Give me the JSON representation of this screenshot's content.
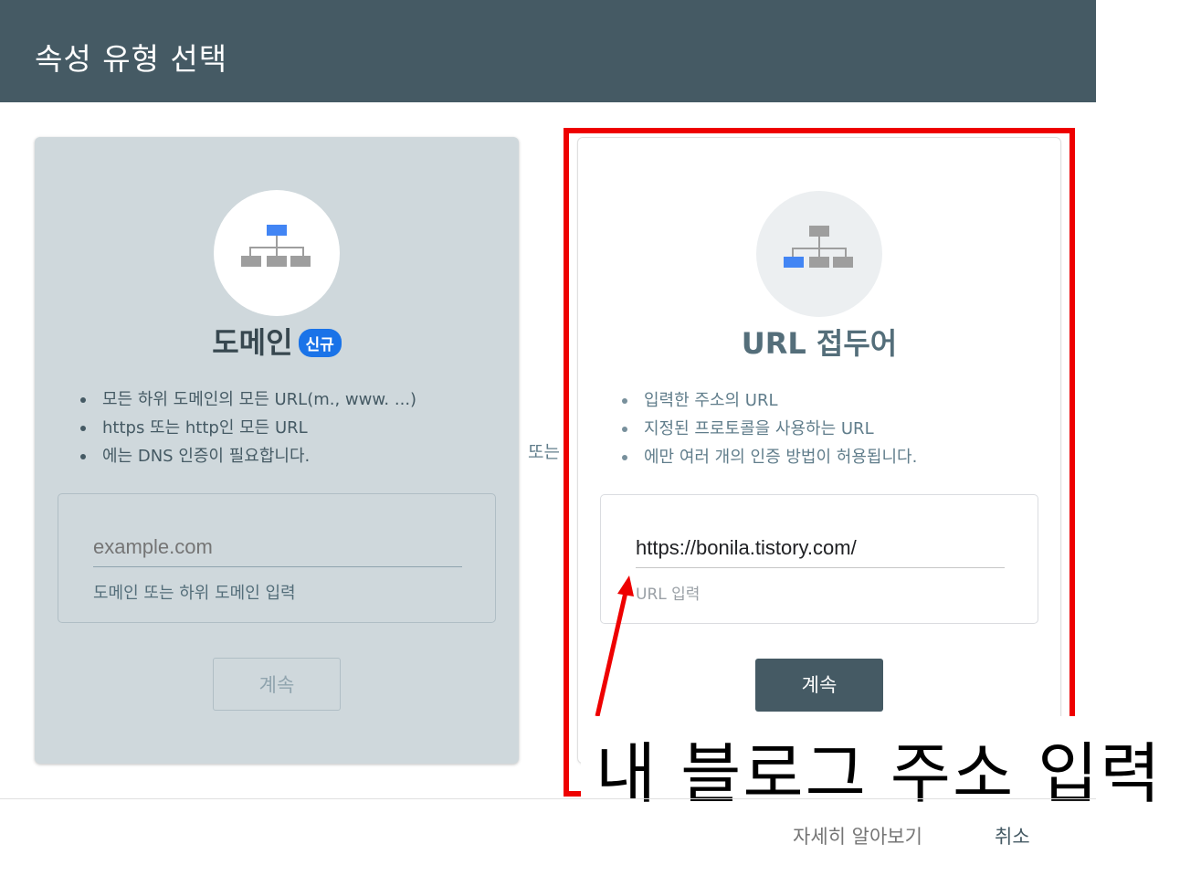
{
  "header": {
    "title": "속성 유형 선택"
  },
  "domain_card": {
    "title": "도메인",
    "badge": "신규",
    "bullets": [
      "모든 하위 도메인의 모든 URL(m., www. ...)",
      "https 또는 http인 모든 URL",
      "에는 DNS 인증이 필요합니다."
    ],
    "input_placeholder": "example.com",
    "input_helper": "도메인 또는 하위 도메인 입력",
    "continue_label": "계속"
  },
  "or_label": "또는",
  "url_card": {
    "title": "URL 접두어",
    "bullets": [
      "입력한 주소의 URL",
      "지정된 프로토콜을 사용하는 URL",
      "에만 여러 개의 인증 방법이 허용됩니다."
    ],
    "input_value": "https://bonila.tistory.com/",
    "input_helper": "URL 입력",
    "continue_label": "계속"
  },
  "annotation": {
    "text": "내 블로그 주소 입력",
    "color": "#ee0000"
  },
  "footer": {
    "learn_more": "자세히 알아보기",
    "cancel": "취소"
  },
  "colors": {
    "header_bg": "#455a64",
    "accent": "#1a73e8",
    "domain_card_bg": "#cfd8dc"
  },
  "icons": {
    "domain": "sitemap-icon",
    "url_prefix": "sitemap-icon"
  }
}
